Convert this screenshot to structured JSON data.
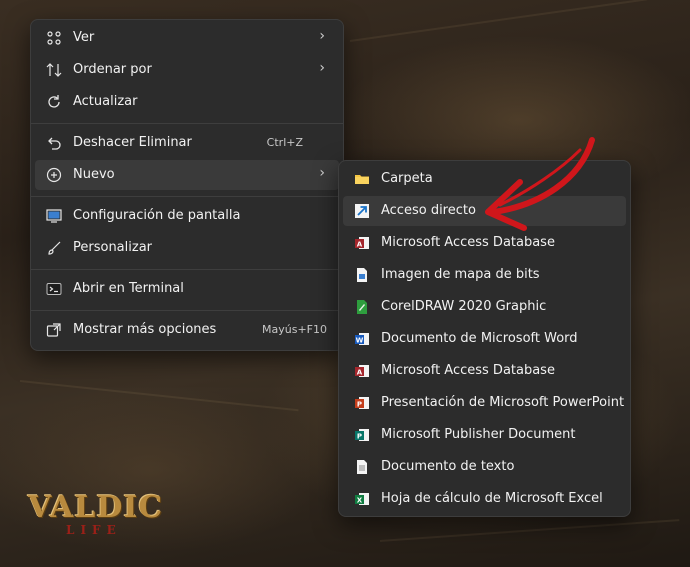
{
  "main_menu": {
    "items": [
      {
        "label": "Ver",
        "icon": "grid-icon"
      },
      {
        "label": "Ordenar por",
        "icon": "sort-icon"
      },
      {
        "label": "Actualizar",
        "icon": "refresh-icon"
      },
      {
        "label": "Deshacer Eliminar",
        "shortcut": "Ctrl+Z",
        "icon": "undo-icon"
      },
      {
        "label": "Nuevo",
        "icon": "add-circle-icon"
      },
      {
        "label": "Configuración de pantalla",
        "icon": "display-settings-icon"
      },
      {
        "label": "Personalizar",
        "icon": "brush-icon"
      },
      {
        "label": "Abrir en Terminal",
        "icon": "terminal-icon"
      },
      {
        "label": "Mostrar más opciones",
        "shortcut": "Mayús+F10",
        "icon": "share-icon"
      }
    ]
  },
  "sub_menu": {
    "items": [
      {
        "label": "Carpeta",
        "icon": "folder-icon"
      },
      {
        "label": "Acceso directo",
        "icon": "shortcut-icon"
      },
      {
        "label": "Microsoft Access Database",
        "icon": "access-icon"
      },
      {
        "label": "Imagen de mapa de bits",
        "icon": "bitmap-icon"
      },
      {
        "label": "CorelDRAW 2020 Graphic",
        "icon": "coreldraw-icon"
      },
      {
        "label": "Documento de Microsoft Word",
        "icon": "word-icon"
      },
      {
        "label": "Microsoft Access Database",
        "icon": "access-icon"
      },
      {
        "label": "Presentación de Microsoft PowerPoint",
        "icon": "powerpoint-icon"
      },
      {
        "label": "Microsoft Publisher Document",
        "icon": "publisher-icon"
      },
      {
        "label": "Documento de texto",
        "icon": "text-document-icon"
      },
      {
        "label": "Hoja de cálculo de Microsoft Excel",
        "icon": "excel-icon"
      }
    ]
  },
  "watermark": {
    "main": "VALDIC",
    "sub": "LIFE"
  },
  "colors": {
    "accent_arrow": "#d0161b",
    "menu_bg": "#2c2c2c",
    "hover_bg": "#3a3a3a"
  }
}
